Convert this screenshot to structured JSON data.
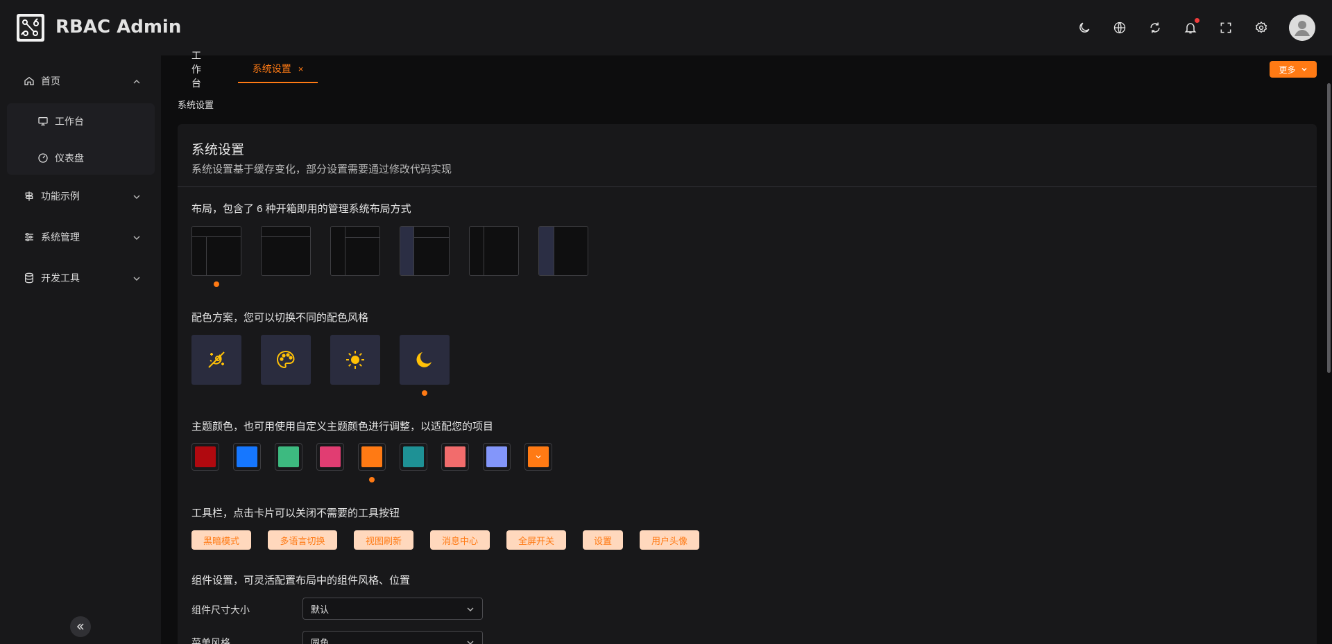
{
  "app": {
    "title": "RBAC Admin"
  },
  "header": {
    "tools": [
      "moon-icon",
      "globe-icon",
      "refresh-icon",
      "bell-icon",
      "fullscreen-icon",
      "gear-icon"
    ],
    "avatar": "user-avatar"
  },
  "sidebar": {
    "items": [
      {
        "label": "首页",
        "icon": "home-icon",
        "expanded": true,
        "children": [
          {
            "label": "工作台",
            "icon": "monitor-icon"
          },
          {
            "label": "仪表盘",
            "icon": "dashboard-icon"
          }
        ]
      },
      {
        "label": "功能示例",
        "icon": "signpost-icon"
      },
      {
        "label": "系统管理",
        "icon": "sliders-icon"
      },
      {
        "label": "开发工具",
        "icon": "database-icon"
      }
    ]
  },
  "tabs": [
    {
      "label": "工作台",
      "active": false
    },
    {
      "label": "系统设置",
      "active": true,
      "close": "×"
    }
  ],
  "more_button": {
    "label": "更多"
  },
  "breadcrumb": "系统设置",
  "settings": {
    "title": "系统设置",
    "description": "系统设置基于缓存变化，部分设置需要通过修改代码实现",
    "layout_section": "布局，包含了 6 种开箱即用的管理系统布局方式",
    "layout_selected_index": 0,
    "color_scheme_section": "配色方案，您可以切换不同的配色风格",
    "color_schemes": [
      "auto-scheme-icon",
      "palette-icon",
      "sun-icon",
      "moon-icon"
    ],
    "color_scheme_selected_index": 3,
    "theme_color_section": "主题颜色，也可用使用自定义主题颜色进行调整，以适配您的项目",
    "theme_colors": [
      "#b0090f",
      "#1677ff",
      "#3dba80",
      "#e13d72",
      "#ff7a14",
      "#1e9195",
      "#f26c6c",
      "#8396fa",
      "#ff7a14"
    ],
    "theme_color_selected_index": 4,
    "toolbar_section": "工具栏，点击卡片可以关闭不需要的工具按钮",
    "toolbar_chips": [
      "黑暗模式",
      "多语言切换",
      "视图刷新",
      "消息中心",
      "全屏开关",
      "设置",
      "用户头像"
    ],
    "component_section": "组件设置，可灵活配置布局中的组件风格、位置",
    "component_size": {
      "label": "组件尺寸大小",
      "value": "默认"
    },
    "menu_style": {
      "label": "菜单风格",
      "value": "圆角"
    }
  },
  "colors": {
    "accent": "#ff7a14",
    "background": "#0d0d0e",
    "panel": "#18181a",
    "chip_bg": "#ffd8bd",
    "icon_yellow": "#ffc107"
  }
}
